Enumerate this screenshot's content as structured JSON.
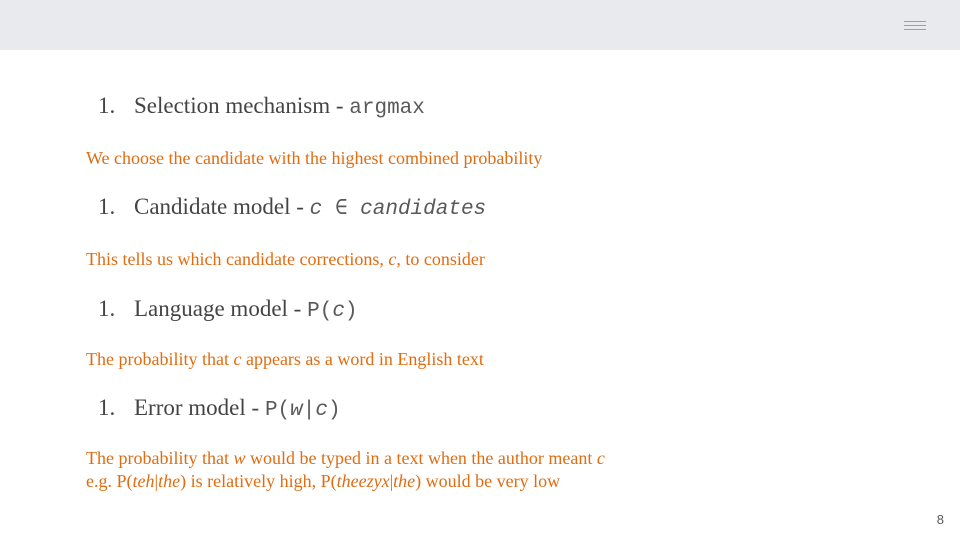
{
  "header": {
    "menu_icon": "hamburger-menu-icon",
    "background": "#e8eaed"
  },
  "colors": {
    "heading_text": "#444444",
    "code_text": "#595959",
    "note_text": "#e06c12"
  },
  "items": [
    {
      "number": "1.",
      "title": "Selection mechanism",
      "sep": " - ",
      "code": "argmax",
      "note": "We choose the candidate with the highest combined probability"
    },
    {
      "number": "1.",
      "title": "Candidate model",
      "sep": " - ",
      "code_var": "c",
      "code_mid": " ∈ ",
      "code_set": "candidates",
      "note_pre": "This tells us which candidate corrections, ",
      "note_var": "c",
      "note_post": ", to consider"
    },
    {
      "number": "1.",
      "title": "Language model",
      "sep": " - ",
      "code_pre": "P(",
      "code_var": "c",
      "code_post": ")",
      "note_pre": "The probability that ",
      "note_var": "c",
      "note_post": " appears as a word in English text"
    },
    {
      "number": "1.",
      "title": "Error model",
      "sep": " - ",
      "code_pre": "P(",
      "code_var1": "w",
      "code_bar": "|",
      "code_var2": "c",
      "code_post": ")",
      "note1_pre": "The probability that ",
      "note1_var1": "w",
      "note1_mid": " would be typed in a text when the author meant ",
      "note1_var2": "c",
      "note2_a": "e.g. P(",
      "note2_b": "teh",
      "note2_c": "|",
      "note2_d": "the",
      "note2_e": ") is relatively high, P(",
      "note2_f": "theezyx",
      "note2_g": "|",
      "note2_h": "the",
      "note2_i": ") would be very low"
    }
  ],
  "footer": {
    "page_number": "8"
  }
}
